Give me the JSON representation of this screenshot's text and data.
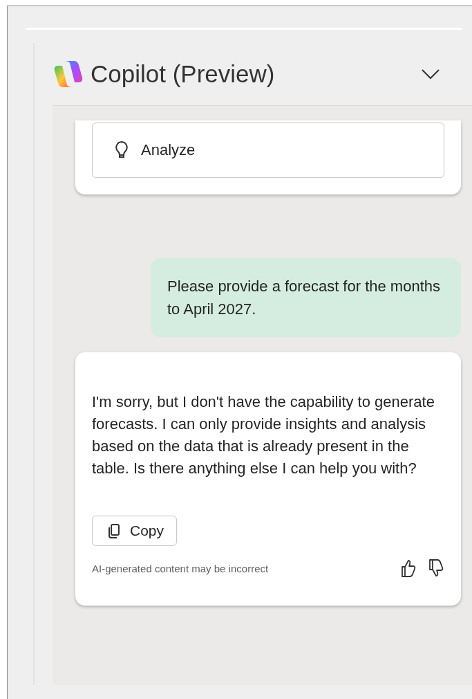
{
  "panel": {
    "title": "Copilot (Preview)"
  },
  "previous_card": {
    "action": "Analyze"
  },
  "messages": [
    {
      "kind": "user",
      "text": "Please provide a forecast for the months to April 2027."
    },
    {
      "kind": "assistant",
      "text": "I'm sorry, but I don't have the capability to generate forecasts. I can only provide insights and analysis based on the data that is already present in the table. Is there anything else I can help you with?",
      "copy_button": "Copy",
      "disclaimer": "AI-generated content may be incorrect"
    }
  ]
}
